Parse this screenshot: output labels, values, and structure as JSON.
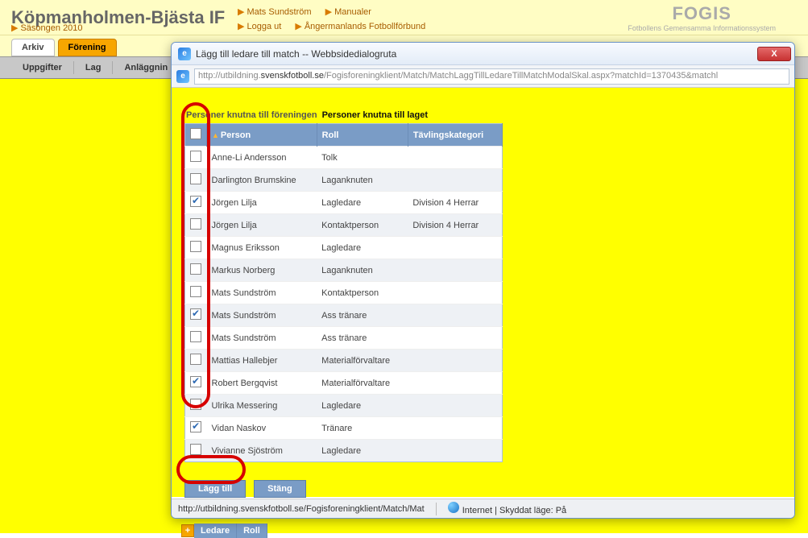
{
  "header": {
    "club": "Köpmanholmen-Bjästa IF",
    "season": "Säsongen 2010",
    "nav1a": "Mats Sundström",
    "nav1b": "Manualer",
    "nav2a": "Logga ut",
    "nav2b": "Ångermanlands Fotbollförbund",
    "fogis": "FOGIS",
    "fogis_sub": "Fotbollens Gemensamma Informationssystem"
  },
  "tabs": {
    "arkiv": "Arkiv",
    "forening": "Förening"
  },
  "subtabs": {
    "uppgifter": "Uppgifter",
    "lag": "Lag",
    "anlaggn": "Anläggnin"
  },
  "dialog": {
    "title": "Lägg till ledare till match -- Webbsidedialogruta",
    "url_host": "svenskfotboll.se",
    "url_pre": "http://utbildning.",
    "url_path": "/Fogisforeningklient/Match/MatchLaggTillLedareTillMatchModalSkal.aspx?matchId=1370435&matchl",
    "subtab_a": "Personer knutna till föreningen",
    "subtab_b": "Personer knutna till laget",
    "col_person": "Person",
    "col_roll": "Roll",
    "col_tavl": "Tävlingskategori",
    "rows": [
      {
        "chk": false,
        "p": "Anne-Li Andersson",
        "r": "Tolk",
        "t": ""
      },
      {
        "chk": false,
        "p": "Darlington Brumskine",
        "r": "Laganknuten",
        "t": ""
      },
      {
        "chk": true,
        "p": "Jörgen Lilja",
        "r": "Lagledare",
        "t": "Division 4 Herrar"
      },
      {
        "chk": false,
        "p": "Jörgen Lilja",
        "r": "Kontaktperson",
        "t": "Division 4 Herrar"
      },
      {
        "chk": false,
        "p": "Magnus Eriksson",
        "r": "Lagledare",
        "t": ""
      },
      {
        "chk": false,
        "p": "Markus Norberg",
        "r": "Laganknuten",
        "t": ""
      },
      {
        "chk": false,
        "p": "Mats Sundström",
        "r": "Kontaktperson",
        "t": ""
      },
      {
        "chk": true,
        "p": "Mats Sundström",
        "r": "Ass tränare",
        "t": ""
      },
      {
        "chk": false,
        "p": "Mats Sundström",
        "r": "Ass tränare",
        "t": ""
      },
      {
        "chk": false,
        "p": "Mattias Hallebjer",
        "r": "Materialförvaltare",
        "t": ""
      },
      {
        "chk": true,
        "p": "Robert Bergqvist",
        "r": "Materialförvaltare",
        "t": ""
      },
      {
        "chk": false,
        "p": "Ulrika Messering",
        "r": "Lagledare",
        "t": ""
      },
      {
        "chk": true,
        "p": "Vidan Naskov",
        "r": "Tränare",
        "t": ""
      },
      {
        "chk": false,
        "p": "Vivianne Sjöström",
        "r": "Lagledare",
        "t": ""
      }
    ],
    "btn_add": "Lägg till",
    "btn_close": "Stäng",
    "status_url": "http://utbildning.svenskfotboll.se/Fogisforeningklient/Match/Mat",
    "status_zone": "Internet | Skyddat läge: På"
  },
  "peek": {
    "ledare": "Ledare",
    "roll": "Roll"
  }
}
